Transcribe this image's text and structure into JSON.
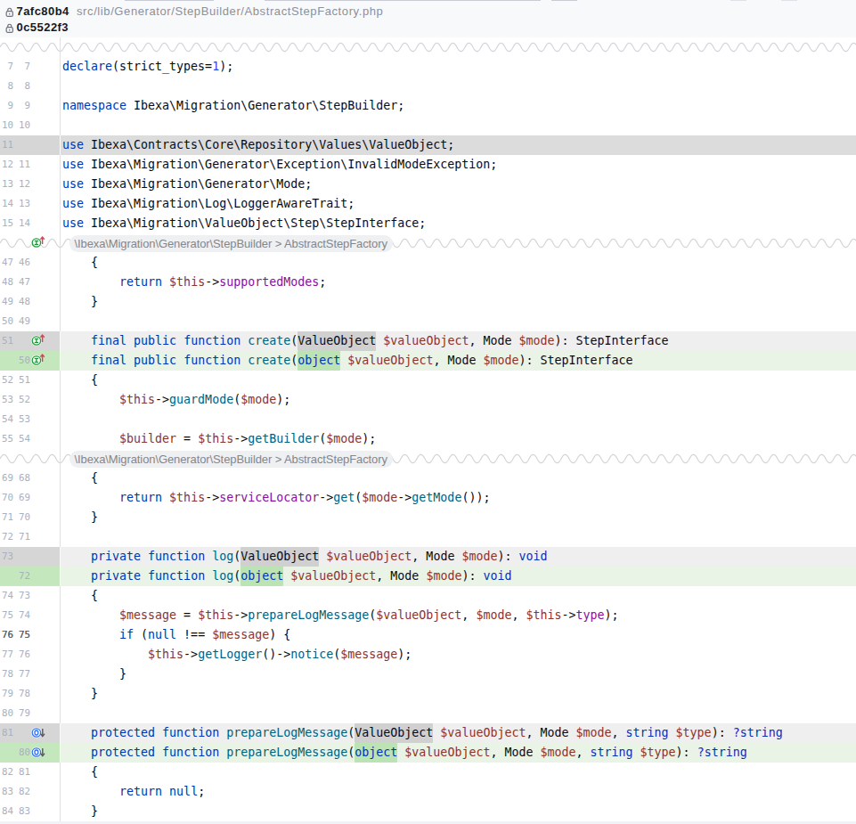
{
  "header": {
    "old_commit": "7afc80b4",
    "new_commit": "0c5522f3",
    "file_path": "src/lib/Generator/StepBuilder/AbstractStepFactory.php"
  },
  "collapsed_region_label": "\\Ibexa\\Migration\\Generator\\StepBuilder > AbstractStepFactory",
  "colors": {
    "keyword": "#0033b3",
    "number": "#1750eb",
    "method": "#00627a",
    "field": "#871094",
    "variable": "#8b3526",
    "deleted_line_bg": "#dcdcdc",
    "deleted_base_bg": "#efefef",
    "deleted_word_bg": "#d0d0d0",
    "deleted_gutter_bg": "#d6d6d6",
    "added_base_bg": "#e9f4e7",
    "added_word_bg": "#bce3b4",
    "added_gutter_bg": "#c5e7bd",
    "header_bg": "#f8f9fb"
  },
  "gutter_icons": {
    "implements": "interface-implements-icon",
    "overridden": "method-overridden-icon"
  },
  "rows": [
    {
      "kind": "sep",
      "label": null,
      "icon": null
    },
    {
      "kind": "ctx",
      "old": "7",
      "new": "7",
      "tokens": [
        [
          "k",
          "declare"
        ],
        [
          "p",
          "(strict_types="
        ],
        [
          "n",
          "1"
        ],
        [
          "p",
          ");"
        ]
      ]
    },
    {
      "kind": "ctx",
      "old": "8",
      "new": "8",
      "tokens": []
    },
    {
      "kind": "ctx",
      "old": "9",
      "new": "9",
      "tokens": [
        [
          "k",
          "namespace"
        ],
        [
          "p",
          " Ibexa\\Migration\\Generator\\StepBuilder;"
        ]
      ]
    },
    {
      "kind": "ctx",
      "old": "10",
      "new": "10",
      "tokens": []
    },
    {
      "kind": "del",
      "full": true,
      "old": "11",
      "new": "",
      "tokens": [
        [
          "k",
          "use"
        ],
        [
          "p",
          " Ibexa\\Contracts\\Core\\Repository\\Values\\ValueObject;"
        ]
      ]
    },
    {
      "kind": "ctx",
      "old": "12",
      "new": "11",
      "tokens": [
        [
          "k",
          "use"
        ],
        [
          "p",
          " Ibexa\\Migration\\Generator\\Exception\\InvalidModeException;"
        ]
      ]
    },
    {
      "kind": "ctx",
      "old": "13",
      "new": "12",
      "tokens": [
        [
          "k",
          "use"
        ],
        [
          "p",
          " Ibexa\\Migration\\Generator\\Mode;"
        ]
      ]
    },
    {
      "kind": "ctx",
      "old": "14",
      "new": "13",
      "tokens": [
        [
          "k",
          "use"
        ],
        [
          "p",
          " Ibexa\\Migration\\Log\\LoggerAwareTrait;"
        ]
      ]
    },
    {
      "kind": "ctx",
      "old": "15",
      "new": "14",
      "tokens": [
        [
          "k",
          "use"
        ],
        [
          "p",
          " Ibexa\\Migration\\ValueObject\\Step\\StepInterface;"
        ]
      ]
    },
    {
      "kind": "sep",
      "label": "\\Ibexa\\Migration\\Generator\\StepBuilder > AbstractStepFactory",
      "icon": "impl"
    },
    {
      "kind": "ctx",
      "old": "47",
      "new": "46",
      "tokens": [
        [
          "p",
          "    {"
        ]
      ]
    },
    {
      "kind": "ctx",
      "old": "48",
      "new": "47",
      "tokens": [
        [
          "p",
          "        "
        ],
        [
          "k",
          "return"
        ],
        [
          "p",
          " "
        ],
        [
          "v",
          "$this"
        ],
        [
          "p",
          "->"
        ],
        [
          "d",
          "supportedModes"
        ],
        [
          "p",
          ";"
        ]
      ]
    },
    {
      "kind": "ctx",
      "old": "49",
      "new": "48",
      "tokens": [
        [
          "p",
          "    }"
        ]
      ]
    },
    {
      "kind": "ctx",
      "old": "50",
      "new": "49",
      "tokens": []
    },
    {
      "kind": "del",
      "old": "51",
      "new": "",
      "icon": "impl",
      "tokens": [
        [
          "p",
          "    "
        ],
        [
          "k",
          "final"
        ],
        [
          "p",
          " "
        ],
        [
          "k",
          "public"
        ],
        [
          "p",
          " "
        ],
        [
          "k",
          "function"
        ],
        [
          "p",
          " "
        ],
        [
          "f",
          "create"
        ],
        [
          "p",
          "("
        ],
        [
          "ph",
          "ValueObject"
        ],
        [
          "p",
          " "
        ],
        [
          "v",
          "$valueObject"
        ],
        [
          "p",
          ", Mode "
        ],
        [
          "v",
          "$mode"
        ],
        [
          "p",
          "): StepInterface"
        ]
      ]
    },
    {
      "kind": "add",
      "old": "",
      "new": "50",
      "icon": "impl",
      "tokens": [
        [
          "p",
          "    "
        ],
        [
          "k",
          "final"
        ],
        [
          "p",
          " "
        ],
        [
          "k",
          "public"
        ],
        [
          "p",
          " "
        ],
        [
          "k",
          "function"
        ],
        [
          "p",
          " "
        ],
        [
          "f",
          "create"
        ],
        [
          "p",
          "("
        ],
        [
          "kh",
          "object"
        ],
        [
          "p",
          " "
        ],
        [
          "v",
          "$valueObject"
        ],
        [
          "p",
          ", Mode "
        ],
        [
          "v",
          "$mode"
        ],
        [
          "p",
          "): StepInterface"
        ]
      ]
    },
    {
      "kind": "ctx",
      "old": "52",
      "new": "51",
      "tokens": [
        [
          "p",
          "    {"
        ]
      ]
    },
    {
      "kind": "ctx",
      "old": "53",
      "new": "52",
      "tokens": [
        [
          "p",
          "        "
        ],
        [
          "v",
          "$this"
        ],
        [
          "p",
          "->"
        ],
        [
          "f",
          "guardMode"
        ],
        [
          "p",
          "("
        ],
        [
          "v",
          "$mode"
        ],
        [
          "p",
          ");"
        ]
      ]
    },
    {
      "kind": "ctx",
      "old": "54",
      "new": "53",
      "tokens": []
    },
    {
      "kind": "ctx",
      "old": "55",
      "new": "54",
      "tokens": [
        [
          "p",
          "        "
        ],
        [
          "v",
          "$builder"
        ],
        [
          "p",
          " = "
        ],
        [
          "v",
          "$this"
        ],
        [
          "p",
          "->"
        ],
        [
          "f",
          "getBuilder"
        ],
        [
          "p",
          "("
        ],
        [
          "v",
          "$mode"
        ],
        [
          "p",
          ");"
        ]
      ]
    },
    {
      "kind": "sep",
      "label": "\\Ibexa\\Migration\\Generator\\StepBuilder > AbstractStepFactory",
      "icon": null
    },
    {
      "kind": "ctx",
      "old": "69",
      "new": "68",
      "tokens": [
        [
          "p",
          "    {"
        ]
      ]
    },
    {
      "kind": "ctx",
      "old": "70",
      "new": "69",
      "tokens": [
        [
          "p",
          "        "
        ],
        [
          "k",
          "return"
        ],
        [
          "p",
          " "
        ],
        [
          "v",
          "$this"
        ],
        [
          "p",
          "->"
        ],
        [
          "d",
          "serviceLocator"
        ],
        [
          "p",
          "->"
        ],
        [
          "f",
          "get"
        ],
        [
          "p",
          "("
        ],
        [
          "v",
          "$mode"
        ],
        [
          "p",
          "->"
        ],
        [
          "f",
          "getMode"
        ],
        [
          "p",
          "());"
        ]
      ]
    },
    {
      "kind": "ctx",
      "old": "71",
      "new": "70",
      "tokens": [
        [
          "p",
          "    }"
        ]
      ]
    },
    {
      "kind": "ctx",
      "old": "72",
      "new": "71",
      "tokens": []
    },
    {
      "kind": "del",
      "old": "73",
      "new": "",
      "tokens": [
        [
          "p",
          "    "
        ],
        [
          "k",
          "private"
        ],
        [
          "p",
          " "
        ],
        [
          "k",
          "function"
        ],
        [
          "p",
          " "
        ],
        [
          "f",
          "log"
        ],
        [
          "p",
          "("
        ],
        [
          "ph",
          "ValueObject"
        ],
        [
          "p",
          " "
        ],
        [
          "v",
          "$valueObject"
        ],
        [
          "p",
          ", Mode "
        ],
        [
          "v",
          "$mode"
        ],
        [
          "p",
          "): "
        ],
        [
          "k",
          "void"
        ]
      ]
    },
    {
      "kind": "add",
      "old": "",
      "new": "72",
      "tokens": [
        [
          "p",
          "    "
        ],
        [
          "k",
          "private"
        ],
        [
          "p",
          " "
        ],
        [
          "k",
          "function"
        ],
        [
          "p",
          " "
        ],
        [
          "f",
          "log"
        ],
        [
          "p",
          "("
        ],
        [
          "kh",
          "object"
        ],
        [
          "p",
          " "
        ],
        [
          "v",
          "$valueObject"
        ],
        [
          "p",
          ", Mode "
        ],
        [
          "v",
          "$mode"
        ],
        [
          "p",
          "): "
        ],
        [
          "k",
          "void"
        ]
      ]
    },
    {
      "kind": "ctx",
      "old": "74",
      "new": "73",
      "tokens": [
        [
          "p",
          "    {"
        ]
      ]
    },
    {
      "kind": "ctx",
      "old": "75",
      "new": "74",
      "tokens": [
        [
          "p",
          "        "
        ],
        [
          "v",
          "$message"
        ],
        [
          "p",
          " = "
        ],
        [
          "v",
          "$this"
        ],
        [
          "p",
          "->"
        ],
        [
          "f",
          "prepareLogMessage"
        ],
        [
          "p",
          "("
        ],
        [
          "v",
          "$valueObject"
        ],
        [
          "p",
          ", "
        ],
        [
          "v",
          "$mode"
        ],
        [
          "p",
          ", "
        ],
        [
          "v",
          "$this"
        ],
        [
          "p",
          "->"
        ],
        [
          "d",
          "type"
        ],
        [
          "p",
          ");"
        ]
      ]
    },
    {
      "kind": "ctx",
      "cur": true,
      "old": "76",
      "new": "75",
      "tokens": [
        [
          "p",
          "        "
        ],
        [
          "k",
          "if"
        ],
        [
          "p",
          " ("
        ],
        [
          "k",
          "null"
        ],
        [
          "p",
          " !== "
        ],
        [
          "v",
          "$message"
        ],
        [
          "p",
          ") {"
        ]
      ]
    },
    {
      "kind": "ctx",
      "old": "77",
      "new": "76",
      "tokens": [
        [
          "p",
          "            "
        ],
        [
          "v",
          "$this"
        ],
        [
          "p",
          "->"
        ],
        [
          "f",
          "getLogger"
        ],
        [
          "p",
          "()->"
        ],
        [
          "f",
          "notice"
        ],
        [
          "p",
          "("
        ],
        [
          "v",
          "$message"
        ],
        [
          "p",
          ");"
        ]
      ]
    },
    {
      "kind": "ctx",
      "old": "78",
      "new": "77",
      "tokens": [
        [
          "p",
          "        }"
        ]
      ]
    },
    {
      "kind": "ctx",
      "old": "79",
      "new": "78",
      "tokens": [
        [
          "p",
          "    }"
        ]
      ]
    },
    {
      "kind": "ctx",
      "old": "80",
      "new": "79",
      "tokens": []
    },
    {
      "kind": "del",
      "old": "81",
      "new": "",
      "icon": "over",
      "tokens": [
        [
          "p",
          "    "
        ],
        [
          "k",
          "protected"
        ],
        [
          "p",
          " "
        ],
        [
          "k",
          "function"
        ],
        [
          "p",
          " "
        ],
        [
          "f",
          "prepareLogMessage"
        ],
        [
          "p",
          "("
        ],
        [
          "ph",
          "ValueObject"
        ],
        [
          "p",
          " "
        ],
        [
          "v",
          "$valueObject"
        ],
        [
          "p",
          ", Mode "
        ],
        [
          "v",
          "$mode"
        ],
        [
          "p",
          ", "
        ],
        [
          "k",
          "string"
        ],
        [
          "p",
          " "
        ],
        [
          "v",
          "$type"
        ],
        [
          "p",
          "): "
        ],
        [
          "k",
          "?string"
        ]
      ]
    },
    {
      "kind": "add",
      "old": "",
      "new": "80",
      "icon": "over",
      "tokens": [
        [
          "p",
          "    "
        ],
        [
          "k",
          "protected"
        ],
        [
          "p",
          " "
        ],
        [
          "k",
          "function"
        ],
        [
          "p",
          " "
        ],
        [
          "f",
          "prepareLogMessage"
        ],
        [
          "p",
          "("
        ],
        [
          "kh",
          "object"
        ],
        [
          "p",
          " "
        ],
        [
          "v",
          "$valueObject"
        ],
        [
          "p",
          ", Mode "
        ],
        [
          "v",
          "$mode"
        ],
        [
          "p",
          ", "
        ],
        [
          "k",
          "string"
        ],
        [
          "p",
          " "
        ],
        [
          "v",
          "$type"
        ],
        [
          "p",
          "): "
        ],
        [
          "k",
          "?string"
        ]
      ]
    },
    {
      "kind": "ctx",
      "old": "82",
      "new": "81",
      "tokens": [
        [
          "p",
          "    {"
        ]
      ]
    },
    {
      "kind": "ctx",
      "old": "83",
      "new": "82",
      "tokens": [
        [
          "p",
          "        "
        ],
        [
          "k",
          "return"
        ],
        [
          "p",
          " "
        ],
        [
          "k",
          "null"
        ],
        [
          "p",
          ";"
        ]
      ]
    },
    {
      "kind": "ctx",
      "old": "84",
      "new": "83",
      "tokens": [
        [
          "p",
          "    }"
        ]
      ]
    }
  ]
}
